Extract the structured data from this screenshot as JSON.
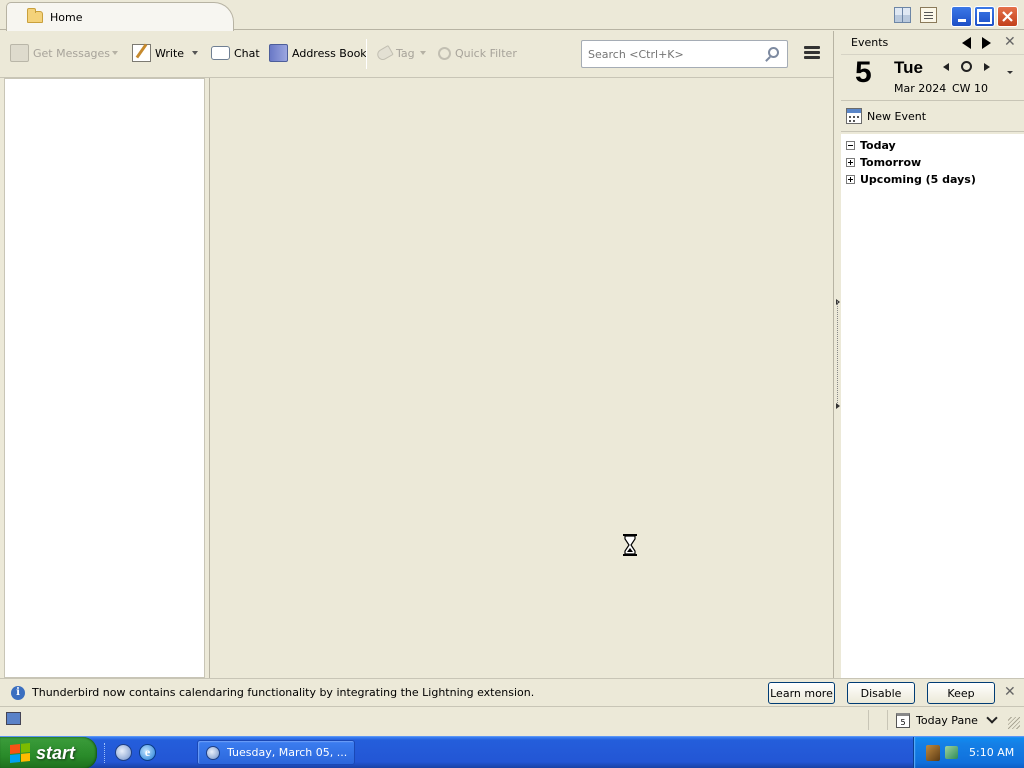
{
  "tab": {
    "home_label": "Home"
  },
  "toolbar": {
    "get_messages": "Get Messages",
    "write": "Write",
    "chat": "Chat",
    "address_book": "Address Book",
    "tag": "Tag",
    "quick_filter": "Quick Filter",
    "search_placeholder": "Search <Ctrl+K>"
  },
  "today_pane": {
    "header": "Events",
    "day_number": "5",
    "day_name": "Tue",
    "month_year": "Mar 2024",
    "calendar_week": "CW 10",
    "new_event": "New Event",
    "agenda": [
      {
        "label": "Today",
        "expanded": true
      },
      {
        "label": "Tomorrow",
        "expanded": false
      },
      {
        "label": "Upcoming (5 days)",
        "expanded": false
      }
    ]
  },
  "notification": {
    "text": "Thunderbird now contains calendaring functionality by integrating the Lightning extension.",
    "learn_more": "Learn more",
    "disable": "Disable",
    "keep": "Keep",
    "info_glyph": "i"
  },
  "statusbar": {
    "today_pane_label": "Today Pane",
    "mini_cal_day": "5"
  },
  "taskbar": {
    "start_label": "start",
    "task_title": "Tuesday, March 05, ...",
    "clock": "5:10 AM",
    "ie_glyph": "e"
  },
  "colors": {
    "chrome": "#ece9d8",
    "taskbar_blue": "#245edb",
    "start_green": "#298a29",
    "tray_blue": "#1580e6"
  },
  "icons": {
    "tab": "folder-icon",
    "toolbar": [
      "get-messages-icon",
      "write-icon",
      "chat-icon",
      "address-book-icon",
      "tag-icon",
      "quick-filter-icon",
      "search-icon",
      "menu-icon"
    ],
    "today_pane": [
      "calendar-icon"
    ],
    "notification": [
      "info-icon",
      "close-icon"
    ]
  }
}
